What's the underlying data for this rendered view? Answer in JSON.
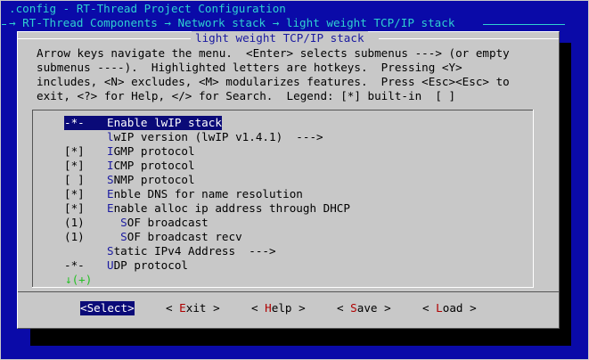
{
  "window": {
    "title": ".config - RT-Thread Project Configuration",
    "breadcrumb": "→ RT-Thread Components → Network stack → light weight TCP/IP stack"
  },
  "dialog": {
    "title": "light weight TCP/IP stack",
    "help_lines": [
      "Arrow keys navigate the menu.  <Enter> selects submenus ---> (or empty",
      "submenus ----).  Highlighted letters are hotkeys.  Pressing <Y>",
      "includes, <N> excludes, <M> modularizes features.  Press <Esc><Esc> to",
      "exit, <?> for Help, </> for Search.  Legend: [*] built-in  [ ]"
    ]
  },
  "menu": {
    "items": [
      {
        "prefix": "-*-",
        "hotkey": "E",
        "rest": "nable lwIP stack",
        "selected": true
      },
      {
        "prefix": "",
        "hotkey": "l",
        "rest": "wIP version (lwIP v1.4.1)  --->"
      },
      {
        "prefix": "[*]",
        "hotkey": "I",
        "rest": "GMP protocol"
      },
      {
        "prefix": "[*]",
        "hotkey": "I",
        "rest": "CMP protocol"
      },
      {
        "prefix": "[ ]",
        "hotkey": "S",
        "rest": "NMP protocol"
      },
      {
        "prefix": "[*]",
        "hotkey": "E",
        "rest": "nble DNS for name resolution"
      },
      {
        "prefix": "[*]",
        "hotkey": "E",
        "rest": "nable alloc ip address through DHCP"
      },
      {
        "prefix": "(1)",
        "indent": "  ",
        "hotkey": "S",
        "rest": "OF broadcast"
      },
      {
        "prefix": "(1)",
        "indent": "  ",
        "hotkey": "S",
        "rest": "OF broadcast recv"
      },
      {
        "prefix": "",
        "hotkey": "S",
        "rest": "tatic IPv4 Address  --->"
      },
      {
        "prefix": "-*-",
        "hotkey": "U",
        "rest": "DP protocol"
      }
    ],
    "more_indicator": "↓(+)"
  },
  "buttons": {
    "select": "<Select>",
    "exit_pre": "< ",
    "exit_hot": "E",
    "exit_rest": "xit >",
    "help_pre": "< ",
    "help_hot": "H",
    "help_rest": "elp >",
    "save_pre": "< ",
    "save_hot": "S",
    "save_rest": "ave >",
    "load_pre": "< ",
    "load_hot": "L",
    "load_rest": "oad >"
  },
  "colors": {
    "background": "#0a0aa8",
    "title_text": "#2fd0d0",
    "dialog_bg": "#c8c8c8",
    "hotkey": "#1a1aa0",
    "button_hotkey": "#b00000",
    "selection": "#0a0a78",
    "more_indicator": "#25c025"
  }
}
